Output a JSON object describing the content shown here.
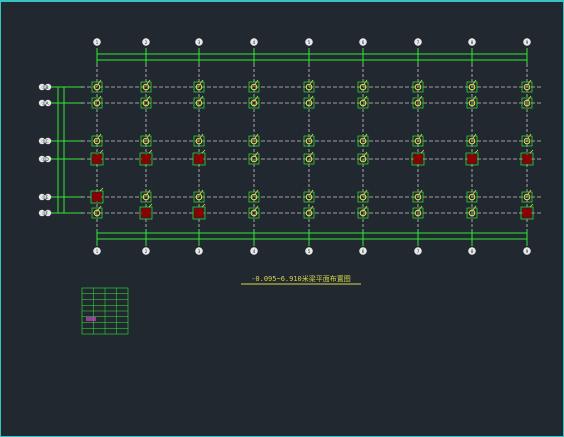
{
  "drawing": {
    "title": "-0.095~6.910米梁平面布置图",
    "background": "#212830",
    "frame_color": "#35c4c4",
    "dim_color": "#34e834",
    "grid_color": "#c8c8c8",
    "bubble_color": "#e8e8e8",
    "column_small_color": "#e8e040",
    "column_big_color": "#8b0000",
    "title_color": "#d6d64a"
  },
  "axes": {
    "columns": [
      "1",
      "2",
      "3",
      "4",
      "5",
      "6",
      "7",
      "8",
      "9"
    ],
    "rows": [
      "A",
      "B",
      "C",
      "D",
      "E",
      "F"
    ],
    "row_labels": [
      "⑦B",
      "⑦A",
      "⑦C",
      "⑦D",
      "⑦E",
      "⑦F"
    ]
  },
  "columns_big": [
    [
      1,
      3
    ],
    [
      2,
      3
    ],
    [
      3,
      3
    ],
    [
      7,
      3
    ],
    [
      8,
      3
    ],
    [
      9,
      3
    ],
    [
      1,
      4
    ],
    [
      2,
      5
    ],
    [
      3,
      5
    ],
    [
      9,
      5
    ]
  ],
  "legend_table": {
    "rows": 8,
    "cols": 4
  }
}
